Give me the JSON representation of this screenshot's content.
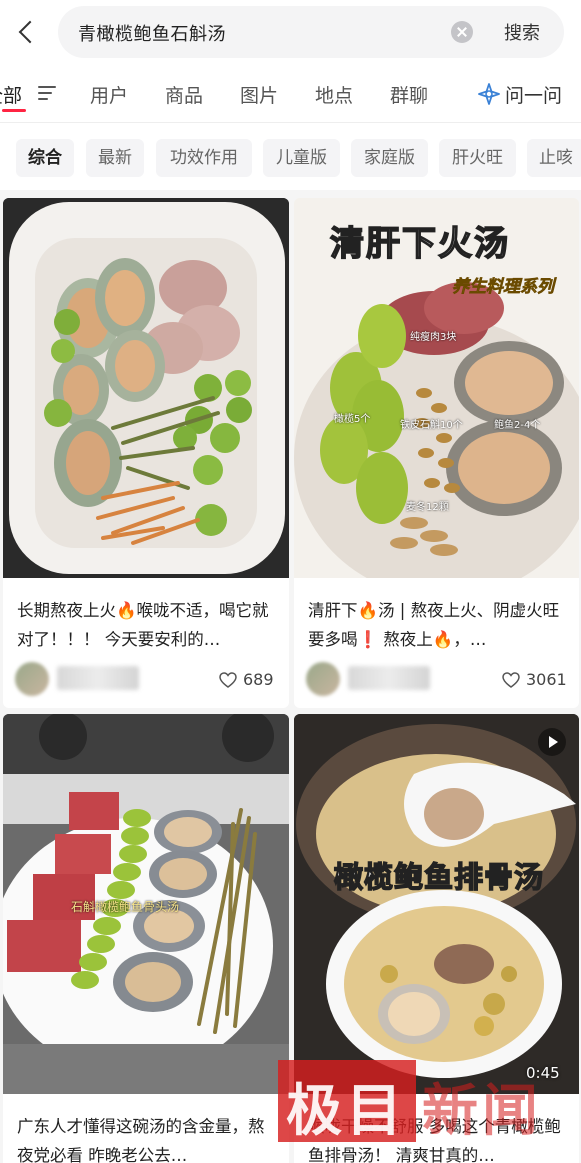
{
  "search": {
    "query": "青橄榄鲍鱼石斛汤",
    "submit_label": "搜索"
  },
  "tabs": [
    {
      "label": "全部",
      "active": true
    },
    {
      "label": "用户"
    },
    {
      "label": "商品"
    },
    {
      "label": "图片"
    },
    {
      "label": "地点"
    },
    {
      "label": "群聊"
    },
    {
      "label": "问一问",
      "icon": "sparkle-icon"
    }
  ],
  "chips": [
    "综合",
    "最新",
    "功效作用",
    "儿童版",
    "家庭版",
    "肝火旺",
    "止咳"
  ],
  "cards": [
    {
      "title": "长期熬夜上火🔥喉咙不适，喝它就对了！！！ 今天要安利的…",
      "likes": "689"
    },
    {
      "title": "清肝下🔥汤 | 熬夜上火、阴虚火旺要多喝❗ 熬夜上🔥，…",
      "likes": "3061",
      "image_text": {
        "headline": "清肝下火汤",
        "subtitle": "养生料理系列",
        "labels": [
          "纯瘦肉3块",
          "橄榄5个",
          "铁皮石斛10个",
          "鲍鱼2-4个",
          "麦冬12颗"
        ]
      }
    },
    {
      "title": "广东人才懂得这碗汤的含金量，熬夜党必看 昨晚老公去…",
      "image_text": {
        "overlay": "石斛橄榄鲍鱼骨头汤"
      }
    },
    {
      "title": "喉咙干燥不舒服 多喝这个青橄榄鲍鱼排骨汤！ 清爽甘真的…",
      "image_text": {
        "headline": "橄榄鲍鱼排骨汤"
      },
      "video": true,
      "duration": "0:45"
    }
  ],
  "watermark": {
    "text1": "极目",
    "text2": "新闻"
  },
  "colors": {
    "accent": "#ff2442",
    "chip_bg": "#f4f4f6",
    "feed_bg": "#f5f5f5"
  }
}
